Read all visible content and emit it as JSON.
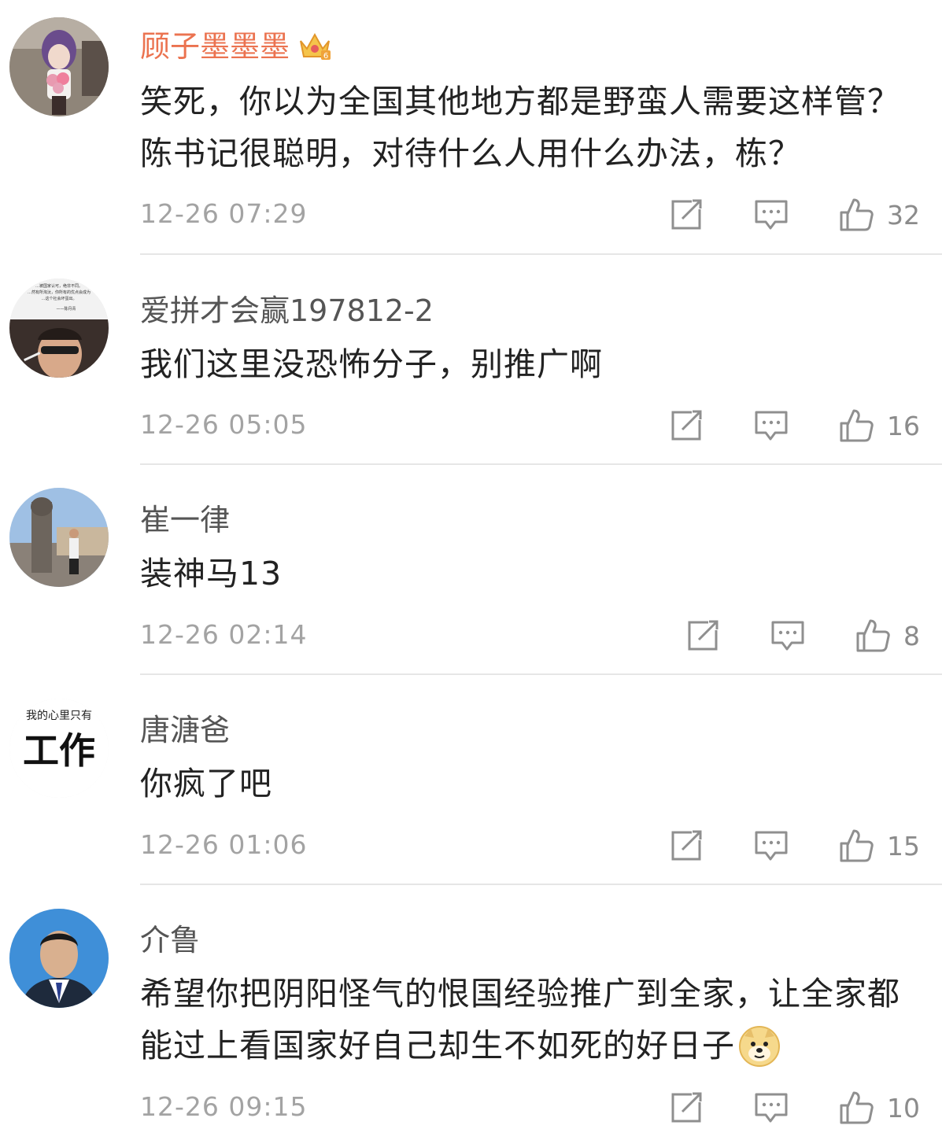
{
  "comments": [
    {
      "username": "顾子墨墨墨",
      "vip": true,
      "text": "笑死，你以为全国其他地方都是野蛮人需要这样管？陈书记很聪明，对待什么人用什么办法，栋？",
      "time": "12-26 07:29",
      "likes": "32"
    },
    {
      "username": "爱拼才会赢197812-2",
      "vip": false,
      "text": "我们这里没恐怖分子，别推广啊",
      "time": "12-26 05:05",
      "likes": "16"
    },
    {
      "username": "崔一律",
      "vip": false,
      "text": "装神马13",
      "time": "12-26 02:14",
      "likes": "8"
    },
    {
      "username": "唐溏爸",
      "vip": false,
      "text": "你疯了吧",
      "time": "12-26 01:06",
      "likes": "15"
    },
    {
      "username": "介鲁",
      "vip": false,
      "text": "希望你把阴阳怪气的恨国经验推广到全家，让全家都能过上看国家好自己却生不如死的好日子",
      "time": "12-26 09:15",
      "likes": "10"
    }
  ],
  "avatar_texts": {
    "c2_quote": [
      "…被国家认可，绝非不同。",
      "…然有所淘汰，你所有的优点会成为",
      "…这个社会坏蛋出。",
      "——陈丹青"
    ],
    "c4_line1": "我的心里只有",
    "c4_line2": "工作"
  },
  "icons": {
    "share": "share-edit-icon",
    "reply": "comment-reply-icon",
    "like": "thumbs-up-icon",
    "vip": "crown-icon",
    "emoji": "doge-icon"
  },
  "colors": {
    "vip_name": "#eb7350",
    "name": "#555555",
    "time": "#a3a3a3",
    "text": "#222222",
    "divider": "#e6e6e6"
  }
}
